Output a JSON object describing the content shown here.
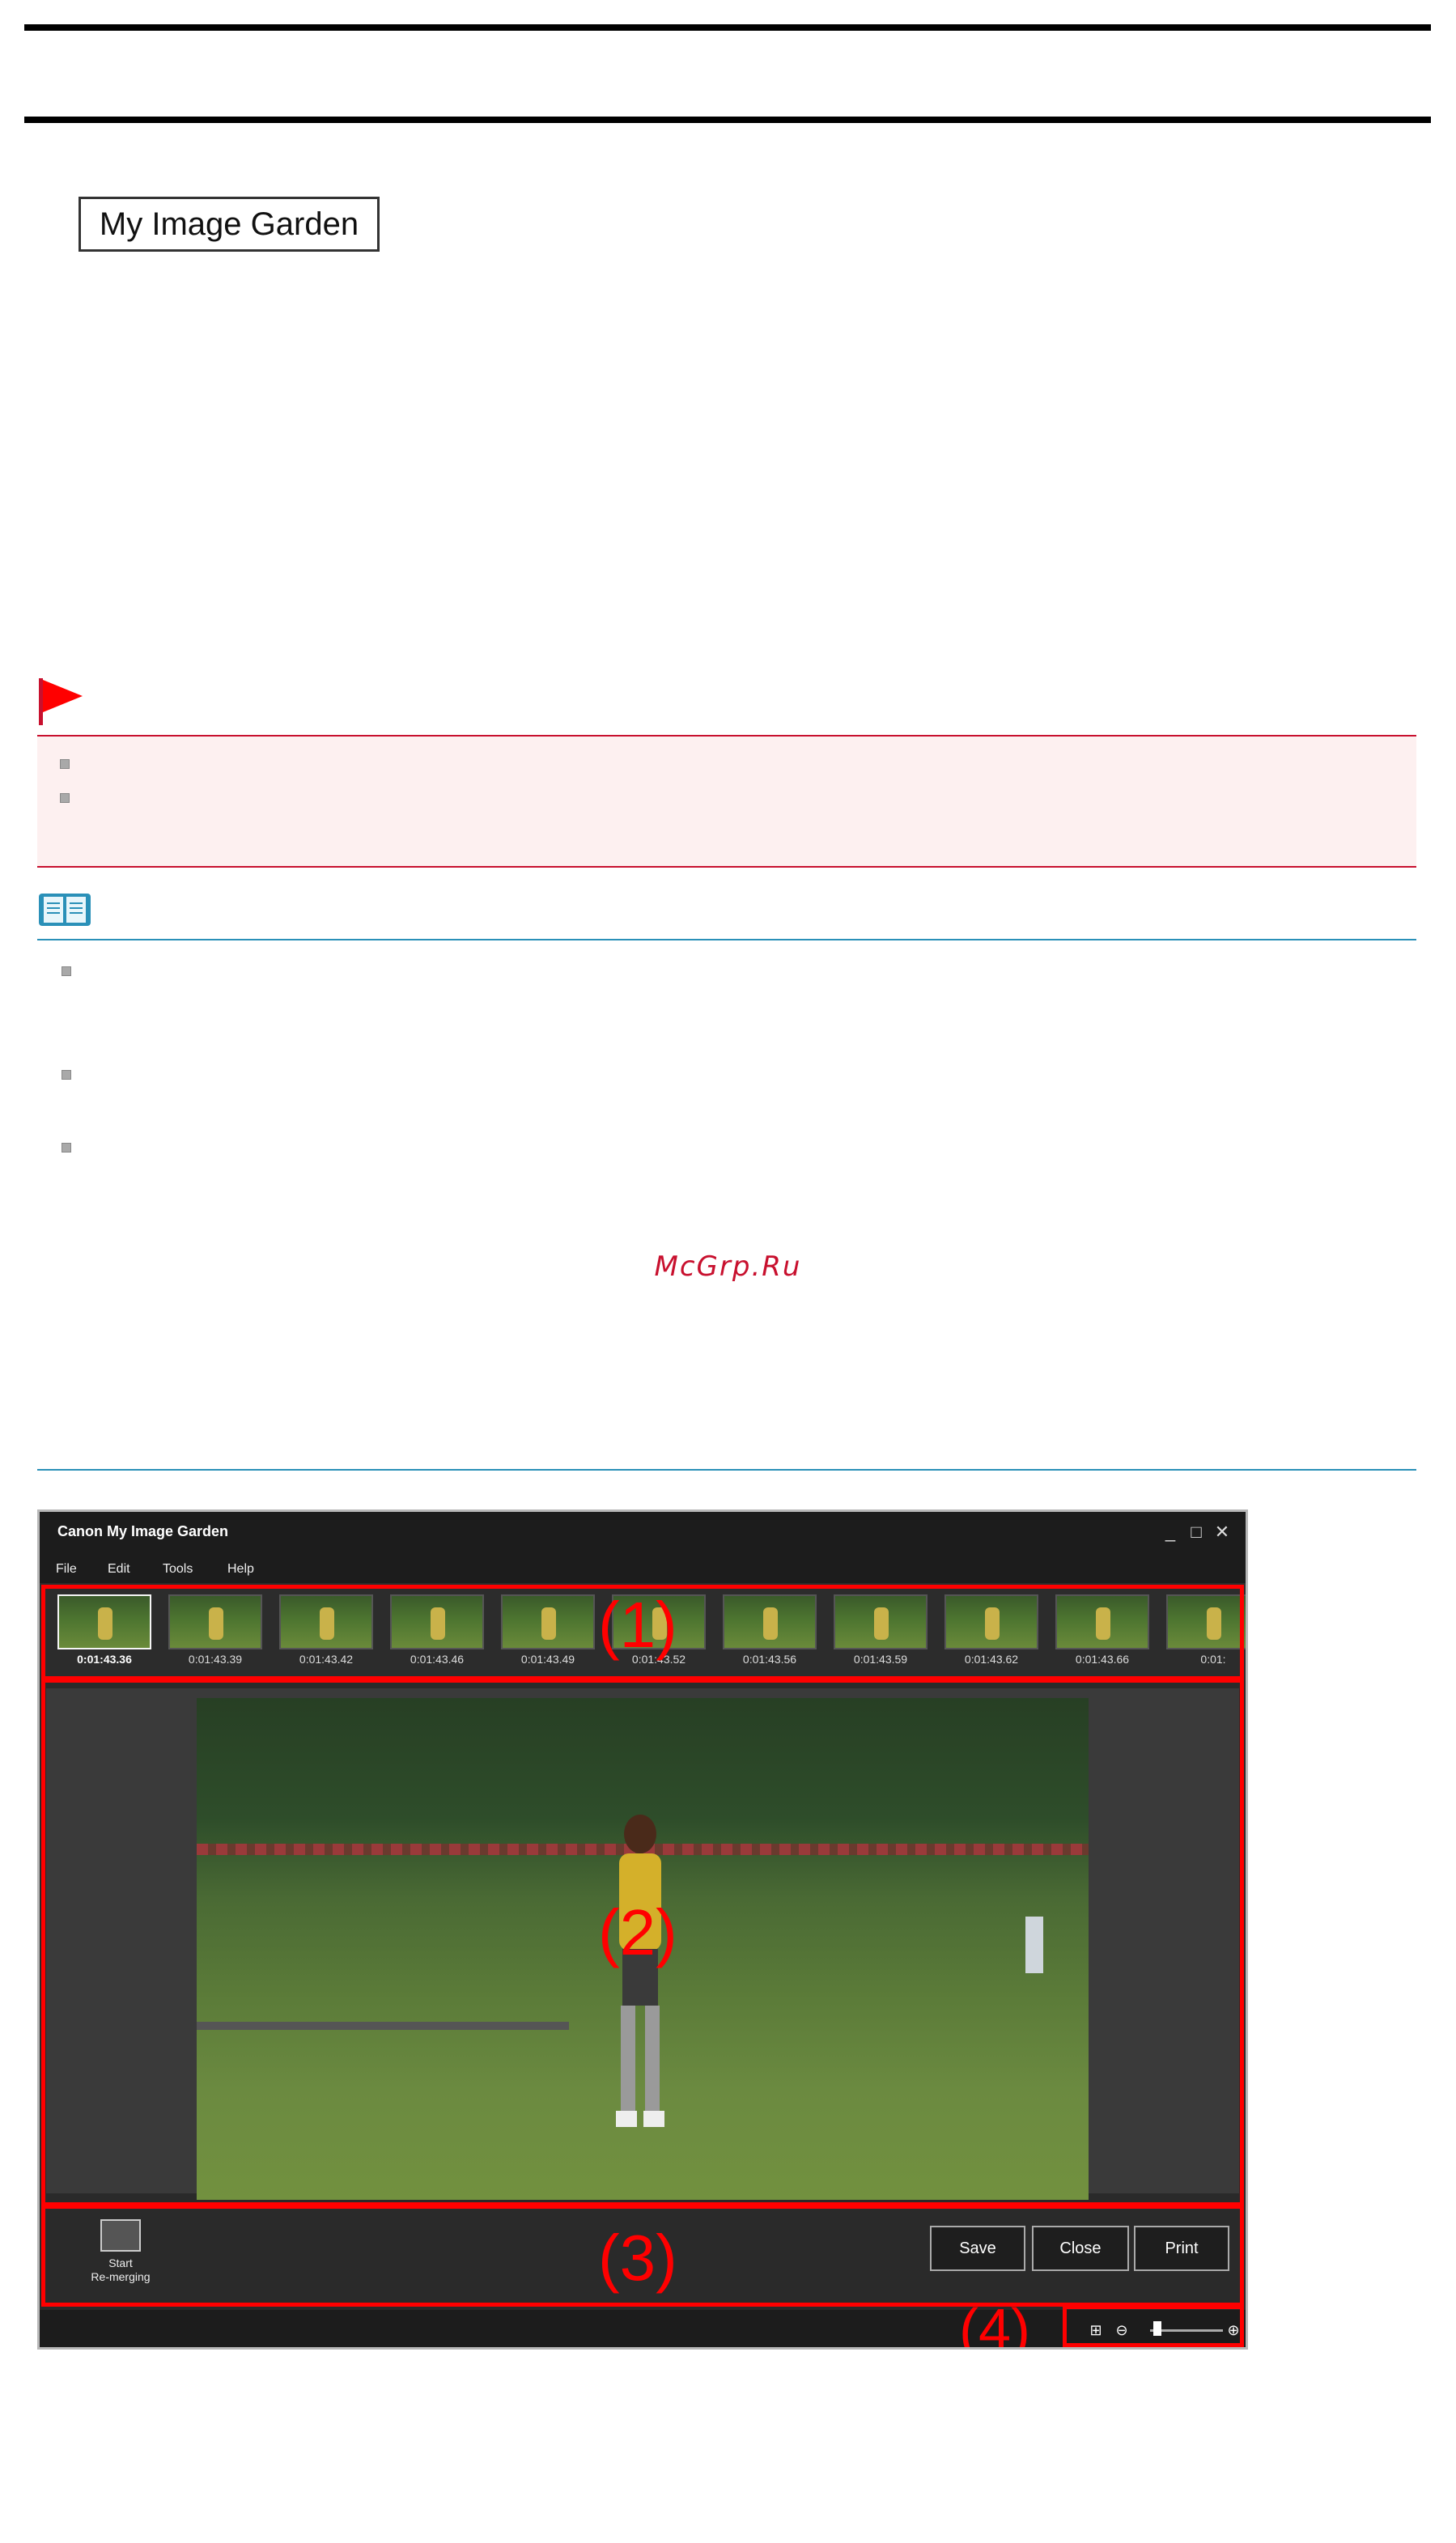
{
  "header": {
    "tag": "My Image Garden"
  },
  "watermark": "McGrp.Ru",
  "app": {
    "title": "Canon My Image Garden",
    "window_controls": [
      "_",
      "□",
      "✕"
    ],
    "menu": [
      "File",
      "Edit",
      "Tools",
      "Help"
    ],
    "frames": [
      {
        "time": "0:01:43.36",
        "selected": true
      },
      {
        "time": "0:01:43.39",
        "selected": false
      },
      {
        "time": "0:01:43.42",
        "selected": false
      },
      {
        "time": "0:01:43.46",
        "selected": false
      },
      {
        "time": "0:01:43.49",
        "selected": false
      },
      {
        "time": "0:01:43.52",
        "selected": false
      },
      {
        "time": "0:01:43.56",
        "selected": false
      },
      {
        "time": "0:01:43.59",
        "selected": false
      },
      {
        "time": "0:01:43.62",
        "selected": false
      },
      {
        "time": "0:01:43.66",
        "selected": false
      },
      {
        "time": "0:01:",
        "selected": false
      }
    ],
    "start_label": "Start\nRe-merging",
    "buttons": {
      "save": "Save",
      "close": "Close",
      "print": "Print"
    },
    "zoom_icons": {
      "fit": "⊞",
      "out": "⊖",
      "in": "⊕"
    },
    "zoom_level": 0.1
  },
  "callouts": {
    "c1": "(1)",
    "c2": "(2)",
    "c3": "(3)",
    "c4": "(4)"
  },
  "colors": {
    "important_red": "#c8102e",
    "note_blue": "#2a90b8",
    "callout_red": "#ff0000"
  }
}
